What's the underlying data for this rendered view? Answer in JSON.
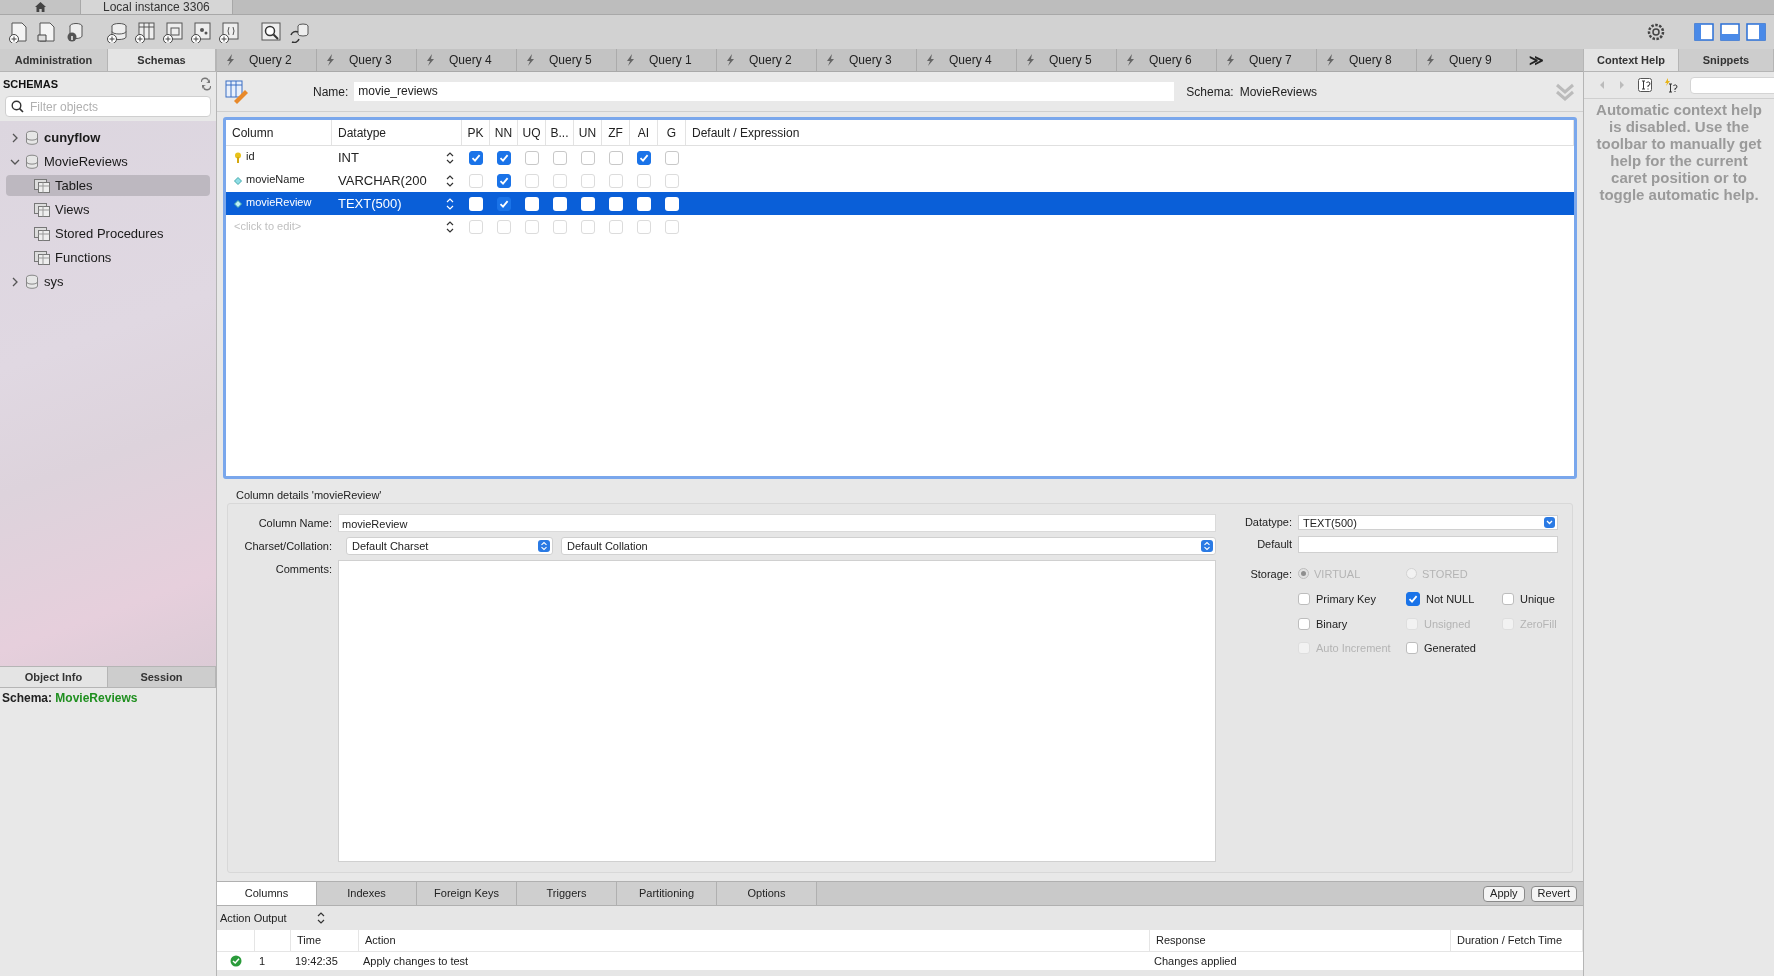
{
  "window_tabs": [
    {
      "kind": "home",
      "selected": false
    },
    {
      "kind": "text",
      "label": "Local instance 3306",
      "selected": true
    }
  ],
  "sidebar": {
    "tabs": [
      {
        "label": "Administration",
        "selected": false
      },
      {
        "label": "Schemas",
        "selected": true
      }
    ],
    "header": "SCHEMAS",
    "filter": {
      "placeholder": "Filter objects"
    },
    "tree": [
      {
        "label": "cunyflow",
        "kind": "schema",
        "is_default": true,
        "expanded": false,
        "selected": false
      },
      {
        "label": "MovieReviews",
        "kind": "schema",
        "is_default": false,
        "expanded": true,
        "selected": false,
        "children": [
          {
            "label": "Tables",
            "kind": "folder",
            "selected": true
          },
          {
            "label": "Views",
            "kind": "folder",
            "selected": false
          },
          {
            "label": "Stored Procedures",
            "kind": "folder",
            "selected": false
          },
          {
            "label": "Functions",
            "kind": "folder",
            "selected": false
          }
        ]
      },
      {
        "label": "sys",
        "kind": "schema",
        "is_default": false,
        "expanded": false,
        "selected": false
      }
    ],
    "bottom_tabs": [
      {
        "label": "Object Info",
        "selected": true
      },
      {
        "label": "Session",
        "selected": false
      }
    ],
    "info": {
      "label": "Schema:",
      "value": "MovieReviews"
    }
  },
  "query_tabs": [
    "Query 2",
    "Query 3",
    "Query 4",
    "Query 5",
    "Query 1",
    "Query 2",
    "Query 3",
    "Query 4",
    "Query 5",
    "Query 6",
    "Query 7",
    "Query 8",
    "Query 9"
  ],
  "overflow": "≫",
  "editor": {
    "name_label": "Name:",
    "name": "movie_reviews",
    "schema_label": "Schema:",
    "schema": "MovieReviews"
  },
  "grid": {
    "columns": [
      "Column",
      "Datatype",
      "PK",
      "NN",
      "UQ",
      "B...",
      "UN",
      "ZF",
      "AI",
      "G",
      "Default / Expression"
    ],
    "rows": [
      {
        "kind": "key",
        "name": "id",
        "datatype": "INT",
        "flags": [
          true,
          true,
          false,
          false,
          false,
          false,
          true,
          false
        ],
        "selected": false
      },
      {
        "kind": "field",
        "name": "movieName",
        "datatype": "VARCHAR(200",
        "flags": [
          false,
          true,
          false,
          false,
          false,
          false,
          false,
          false
        ],
        "selected": false
      },
      {
        "kind": "field",
        "name": "movieReview",
        "datatype": "TEXT(500)",
        "flags": [
          false,
          true,
          false,
          false,
          false,
          false,
          false,
          false
        ],
        "selected": true
      },
      {
        "kind": "new",
        "name": "<click to edit>",
        "datatype": "",
        "flags": [
          false,
          false,
          false,
          false,
          false,
          false,
          false,
          false
        ],
        "selected": false
      }
    ]
  },
  "details": {
    "title": "Column details 'movieReview'",
    "column_name_label": "Column Name:",
    "column_name": "movieReview",
    "charset_label": "Charset/Collation:",
    "charset": "Default Charset",
    "collation": "Default Collation",
    "comments_label": "Comments:",
    "datatype_label": "Datatype:",
    "datatype": "TEXT(500)",
    "default_label": "Default",
    "storage_label": "Storage:",
    "storage": [
      {
        "label": "VIRTUAL",
        "selected": true,
        "disabled": true
      },
      {
        "label": "STORED",
        "selected": false,
        "disabled": true
      }
    ],
    "options": [
      {
        "label": "Primary Key",
        "checked": false,
        "disabled": false
      },
      {
        "label": "Not NULL",
        "checked": true,
        "disabled": false
      },
      {
        "label": "Unique",
        "checked": false,
        "disabled": false
      },
      {
        "label": "Binary",
        "checked": false,
        "disabled": false
      },
      {
        "label": "Unsigned",
        "checked": false,
        "disabled": true
      },
      {
        "label": "ZeroFill",
        "checked": false,
        "disabled": true
      },
      {
        "label": "Auto Increment",
        "checked": false,
        "disabled": true
      },
      {
        "label": "Generated",
        "checked": false,
        "disabled": false
      }
    ]
  },
  "editor_tabs": [
    {
      "label": "Columns",
      "selected": true
    },
    {
      "label": "Indexes",
      "selected": false
    },
    {
      "label": "Foreign Keys",
      "selected": false
    },
    {
      "label": "Triggers",
      "selected": false
    },
    {
      "label": "Partitioning",
      "selected": false
    },
    {
      "label": "Options",
      "selected": false
    }
  ],
  "buttons": [
    "Apply",
    "Revert"
  ],
  "output": {
    "selector": "Action Output",
    "columns": [
      "Time",
      "Action",
      "Response",
      "Duration / Fetch Time"
    ],
    "rows": [
      {
        "success": true,
        "index": "1",
        "time": "19:42:35",
        "action": "Apply changes to test",
        "response": "Changes applied"
      }
    ]
  },
  "right_panel": {
    "tabs": [
      {
        "label": "Context Help",
        "selected": true
      },
      {
        "label": "Snippets",
        "selected": false
      }
    ],
    "help": "Automatic context help is disabled. Use the toolbar to manually get help for the current caret position or to toggle automatic help."
  }
}
